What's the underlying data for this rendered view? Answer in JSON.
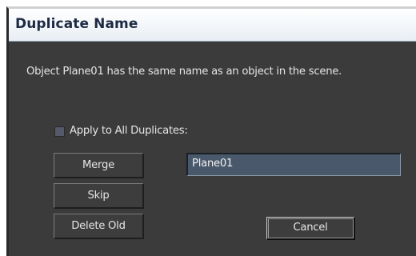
{
  "window": {
    "title": "Duplicate Name"
  },
  "message": "Object Plane01 has the same name as an object in the scene.",
  "apply_all": {
    "label": "Apply to All Duplicates:",
    "checked": false
  },
  "buttons": {
    "merge": "Merge",
    "skip": "Skip",
    "delete_old": "Delete Old",
    "cancel": "Cancel"
  },
  "name_field": {
    "value": "Plane01"
  }
}
